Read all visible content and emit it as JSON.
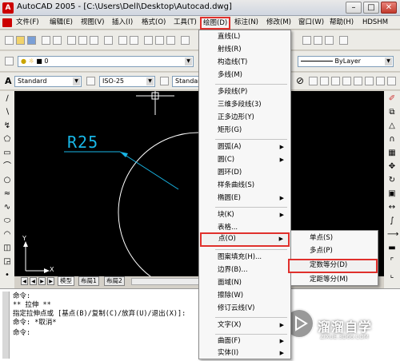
{
  "window": {
    "title": "AutoCAD 2005 - [C:\\Users\\Dell\\Desktop\\Autocad.dwg]",
    "minimize": "–",
    "restore": "□",
    "close": "✕"
  },
  "menubar": {
    "items": [
      "文件(F)",
      "编辑(E)",
      "视图(V)",
      "插入(I)",
      "格式(O)",
      "工具(T)",
      "绘图(D)",
      "标注(N)",
      "修改(M)",
      "窗口(W)",
      "帮助(H)",
      "HDSHM"
    ]
  },
  "toolbar": {
    "layer_value": "0",
    "linetype_value": "ByLayer",
    "text_style": "Standard",
    "dim_style": "ISO-25",
    "table_style": "Standard"
  },
  "canvas": {
    "dimension_label": "R25",
    "ucs_y": "Y",
    "ucs_x": "X"
  },
  "layout_tabs": [
    "模型",
    "布局1",
    "布局2"
  ],
  "command": {
    "lines": [
      "命令:",
      "** 拉伸 **",
      "指定拉伸点或 [基点(B)/复制(C)/放弃(U)/退出(X)]:",
      "命令: *取消*",
      "命令:"
    ]
  },
  "draw_menu": {
    "items": [
      {
        "label": "直线(L)",
        "arrow": ""
      },
      {
        "label": "射线(R)",
        "arrow": ""
      },
      {
        "label": "构造线(T)",
        "arrow": ""
      },
      {
        "label": "多线(M)",
        "arrow": ""
      },
      {
        "label": "多段线(P)",
        "arrow": ""
      },
      {
        "label": "三维多段线(3)",
        "arrow": ""
      },
      {
        "label": "正多边形(Y)",
        "arrow": ""
      },
      {
        "label": "矩形(G)",
        "arrow": ""
      },
      {
        "label": "圆弧(A)",
        "arrow": "▶"
      },
      {
        "label": "圆(C)",
        "arrow": "▶"
      },
      {
        "label": "圆环(D)",
        "arrow": ""
      },
      {
        "label": "样条曲线(S)",
        "arrow": ""
      },
      {
        "label": "椭圆(E)",
        "arrow": "▶"
      },
      {
        "label": "块(K)",
        "arrow": "▶"
      },
      {
        "label": "表格...",
        "arrow": ""
      },
      {
        "label": "点(O)",
        "arrow": "▶"
      },
      {
        "label": "图案填充(H)...",
        "arrow": ""
      },
      {
        "label": "边界(B)...",
        "arrow": ""
      },
      {
        "label": "面域(N)",
        "arrow": ""
      },
      {
        "label": "擦除(W)",
        "arrow": ""
      },
      {
        "label": "修订云线(V)",
        "arrow": ""
      },
      {
        "label": "文字(X)",
        "arrow": "▶"
      },
      {
        "label": "曲面(F)",
        "arrow": "▶"
      },
      {
        "label": "实体(I)",
        "arrow": "▶"
      }
    ]
  },
  "point_submenu": {
    "items": [
      "单点(S)",
      "多点(P)",
      "定数等分(D)",
      "定距等分(M)"
    ]
  },
  "watermark": {
    "title": "溜溜自学",
    "url": "ZIXUE.3D66.COM"
  },
  "colors": {
    "highlight": "#e0302c",
    "dimension": "#18b6e6",
    "canvas": "#000000"
  }
}
